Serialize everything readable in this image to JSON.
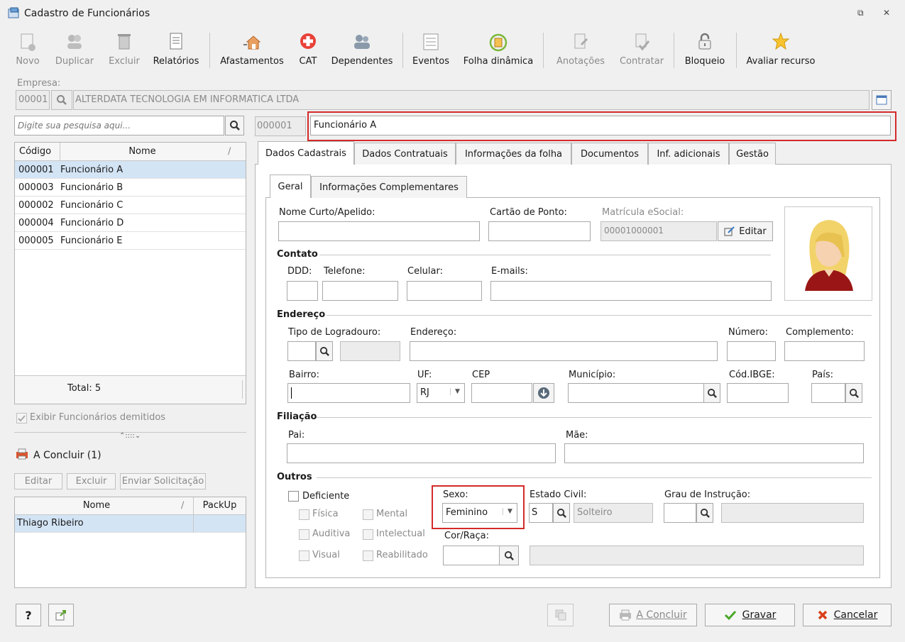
{
  "window": {
    "title": "Cadastro de Funcionários"
  },
  "toolbar": {
    "novo": "Novo",
    "duplicar": "Duplicar",
    "excluir": "Excluir",
    "relatorios": "Relatórios",
    "afastamentos": "Afastamentos",
    "cat": "CAT",
    "dependentes": "Dependentes",
    "eventos": "Eventos",
    "folha_dinamica": "Folha dinâmica",
    "anotacoes": "Anotações",
    "contratar": "Contratar",
    "bloqueio": "Bloqueio",
    "avaliar": "Avaliar recurso"
  },
  "empresa": {
    "label": "Empresa:",
    "code": "00001",
    "name": "ALTERDATA TECNOLOGIA EM INFORMATICA LTDA"
  },
  "search": {
    "placeholder": "Digite sua pesquisa aqui..."
  },
  "employee": {
    "code": "000001",
    "name": "Funcionário A"
  },
  "list": {
    "col_codigo": "Código",
    "col_nome": "Nome",
    "rows": [
      {
        "code": "000001",
        "name": "Funcionário A"
      },
      {
        "code": "000003",
        "name": "Funcionário B"
      },
      {
        "code": "000002",
        "name": "Funcionário C"
      },
      {
        "code": "000004",
        "name": "Funcionário D"
      },
      {
        "code": "000005",
        "name": "Funcionário E"
      }
    ],
    "total": "Total: 5"
  },
  "left": {
    "exibir": "Exibir Funcionários demitidos",
    "a_concluir": "A Concluir (1)",
    "editar": "Editar",
    "excluir": "Excluir",
    "enviar": "Enviar Solicitação",
    "col_nome": "Nome",
    "col_packup": "PackUp",
    "row_name": "Thiago Ribeiro"
  },
  "tabs": [
    "Dados Cadastrais",
    "Dados Contratuais",
    "Informações da folha",
    "Documentos",
    "Inf. adicionais",
    "Gestão"
  ],
  "subtabs": [
    "Geral",
    "Informações Complementares"
  ],
  "form": {
    "nome_curto": "Nome Curto/Apelido:",
    "cartao": "Cartão de Ponto:",
    "matricula": "Matrícula eSocial:",
    "matricula_value": "00001000001",
    "editar": "Editar",
    "contato": "Contato",
    "ddd": "DDD:",
    "telefone": "Telefone:",
    "celular": "Celular:",
    "emails": "E-mails:",
    "endereco_grp": "Endereço",
    "tipo_logradouro": "Tipo de Logradouro:",
    "endereco": "Endereço:",
    "numero": "Número:",
    "complemento": "Complemento:",
    "bairro": "Bairro:",
    "uf": "UF:",
    "uf_value": "RJ",
    "cep": "CEP",
    "municipio": "Município:",
    "cod_ibge": "Cód.IBGE:",
    "pais": "País:",
    "filiacao": "Filiação",
    "pai": "Pai:",
    "mae": "Mãe:",
    "outros": "Outros",
    "deficiente": "Deficiente",
    "fisica": "Física",
    "mental": "Mental",
    "auditiva": "Auditiva",
    "intelectual": "Intelectual",
    "visual": "Visual",
    "reabilitado": "Reabilitado",
    "sexo": "Sexo:",
    "sexo_value": "Feminino",
    "estado_civil": "Estado Civil:",
    "estado_code": "S",
    "estado_value": "Solteiro",
    "grau": "Grau de Instrução:",
    "cor": "Cor/Raça:"
  },
  "footer": {
    "help": "?",
    "a_concluir": "A Concluir",
    "gravar": "Gravar",
    "cancelar": "Cancelar"
  }
}
